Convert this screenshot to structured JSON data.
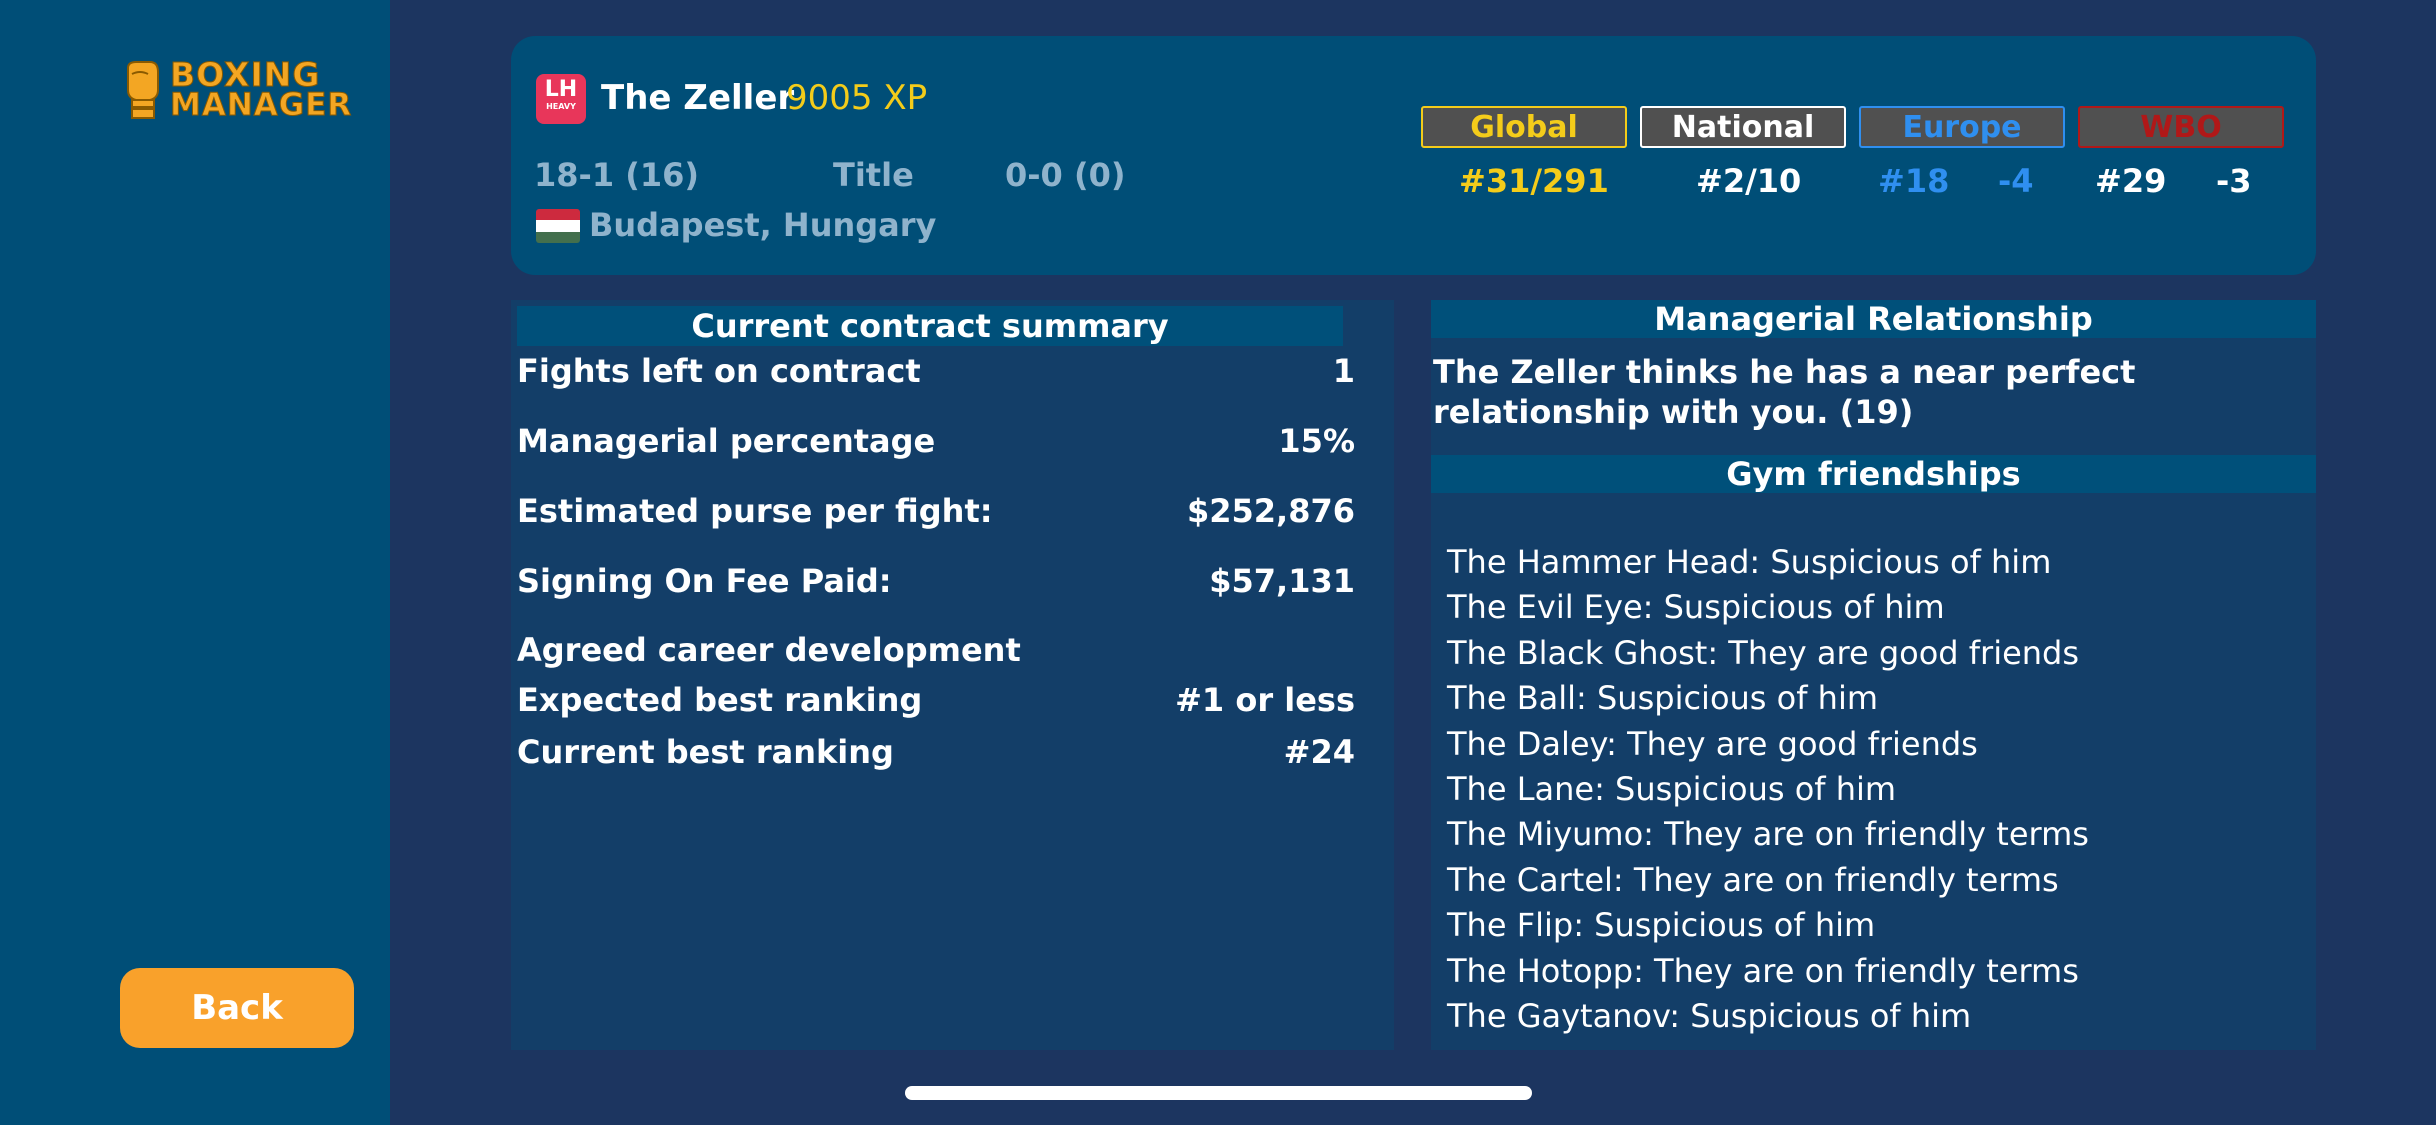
{
  "app": {
    "logo_text_line1": "BOXING",
    "logo_text_line2": "MANAGER",
    "back_label": "Back"
  },
  "boxer": {
    "weight_badge_abbr": "LH",
    "weight_badge_sub": "HEAVY",
    "name": "The Zeller",
    "xp": "9005 XP",
    "record": "18-1 (16)",
    "title_label": "Title",
    "title_record": "0-0 (0)",
    "location": "Budapest, Hungary",
    "flag_colors": [
      "#cd2a3e",
      "#ffffff",
      "#436f4d"
    ]
  },
  "rankings": [
    {
      "label": "Global",
      "value": "#31/291",
      "change": "",
      "color": "#f4cc1a",
      "box_border": "#f4cc1a",
      "box_bg": "#505050"
    },
    {
      "label": "National",
      "value": "#2/10",
      "change": "",
      "color": "#ffffff",
      "box_border": "#ffffff",
      "box_bg": "#505050"
    },
    {
      "label": "Europe",
      "value": "#18",
      "change": "-4",
      "color": "#2f8ff0",
      "box_border": "#2f8ff0",
      "box_bg": "#505050"
    },
    {
      "label": "WBO",
      "value": "#29",
      "change": "-3",
      "color": "#ffffff",
      "label_color": "#b01818",
      "box_border": "#b01818",
      "box_bg": "#505050"
    }
  ],
  "contract": {
    "title": "Current contract summary",
    "rows": [
      {
        "label": "Fights left on contract",
        "value": "1"
      },
      {
        "label": "Managerial percentage",
        "value": "15%"
      },
      {
        "label": "Estimated purse per fight:",
        "value": "$252,876"
      },
      {
        "label": "Signing On Fee Paid:",
        "value": "$57,131"
      },
      {
        "label": "Agreed career development",
        "value": ""
      },
      {
        "label": "Expected best ranking",
        "value": "#1 or less"
      },
      {
        "label": "Current best ranking",
        "value": "#24"
      }
    ]
  },
  "relationship": {
    "title": "Managerial Relationship",
    "text": "The Zeller thinks he has a near perfect relationship with you. (19)"
  },
  "gym": {
    "title": "Gym friendships",
    "friends": [
      "The Hammer Head: Suspicious of him",
      "The Evil Eye: Suspicious of him",
      "The Black Ghost: They are good friends",
      "The Ball: Suspicious of him",
      "The Daley: They are good friends",
      "The Lane: Suspicious of him",
      "The Miyumo: They are on friendly terms",
      "The Cartel: They are on friendly terms",
      "The Flip: Suspicious of him",
      "The Hotopp: They are on friendly terms",
      "The Gaytanov: Suspicious of him"
    ]
  }
}
